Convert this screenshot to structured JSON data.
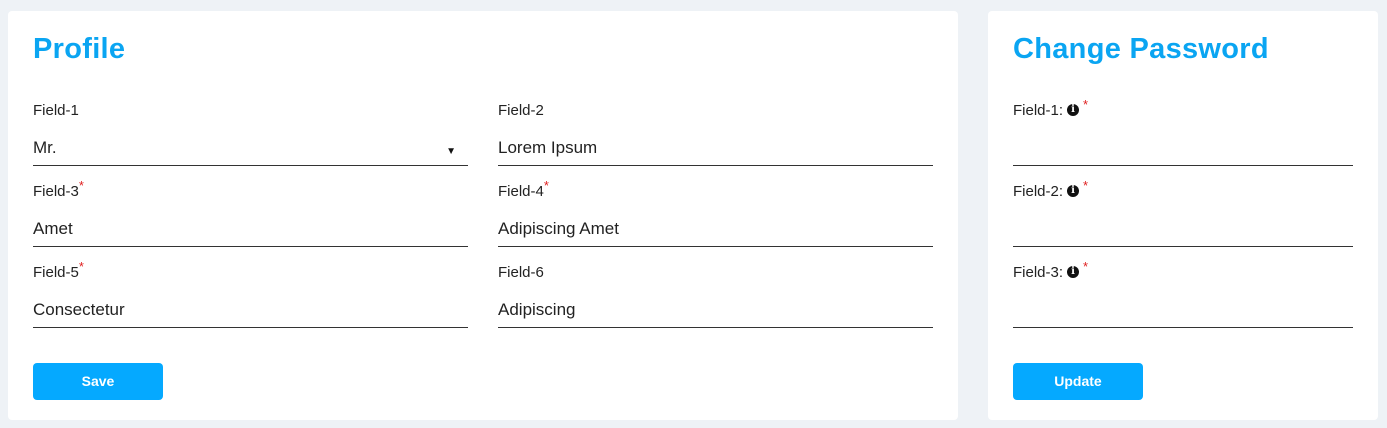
{
  "profile": {
    "title": "Profile",
    "fields": [
      {
        "label": "Field-1",
        "value": "Mr.",
        "required": false
      },
      {
        "label": "Field-2",
        "value": "Lorem Ipsum",
        "required": false
      },
      {
        "label": "Field-3",
        "value": "Amet",
        "required": true
      },
      {
        "label": "Field-4",
        "value": "Adipiscing Amet",
        "required": true
      },
      {
        "label": "Field-5",
        "value": "Consectetur",
        "required": true
      },
      {
        "label": "Field-6",
        "value": "Adipiscing",
        "required": false
      }
    ],
    "save_label": "Save"
  },
  "password": {
    "title": "Change Password",
    "fields": [
      {
        "label": "Field-1:",
        "value": ""
      },
      {
        "label": "Field-2:",
        "value": ""
      },
      {
        "label": "Field-3:",
        "value": ""
      }
    ],
    "update_label": "Update"
  },
  "required_marker": "*",
  "info_icon_glyph": "i",
  "select_arrow": "▼",
  "colors": {
    "title": "#0aa5f2",
    "button": "#05a9ff",
    "required": "#e02020",
    "background": "#eef2f6"
  }
}
